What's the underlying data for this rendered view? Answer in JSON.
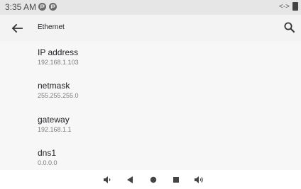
{
  "status_bar": {
    "time": "3:35 AM",
    "notification_icons": [
      "app-notification-icon",
      "app-notification-icon"
    ],
    "right_icons": [
      "data-arrows-icon",
      "battery-icon"
    ],
    "right_text": "<->"
  },
  "toolbar": {
    "back_icon": "arrow-back-icon",
    "title": "Ethernet",
    "search_icon": "search-icon"
  },
  "settings": [
    {
      "label": "IP address",
      "value": "192.168.1.103"
    },
    {
      "label": "netmask",
      "value": "255.255.255.0"
    },
    {
      "label": "gateway",
      "value": "192.168.1.1"
    },
    {
      "label": "dns1",
      "value": "0.0.0.0"
    }
  ],
  "nav_bar": {
    "buttons": [
      "volume-down-icon",
      "back-triangle-icon",
      "home-circle-icon",
      "recents-square-icon",
      "volume-up-icon"
    ]
  },
  "colors": {
    "status_bar_bg": "#e6e6e6",
    "toolbar_bg": "#f3f3f3",
    "content_bg": "#f7f7f7",
    "icon_color": "#444444"
  }
}
